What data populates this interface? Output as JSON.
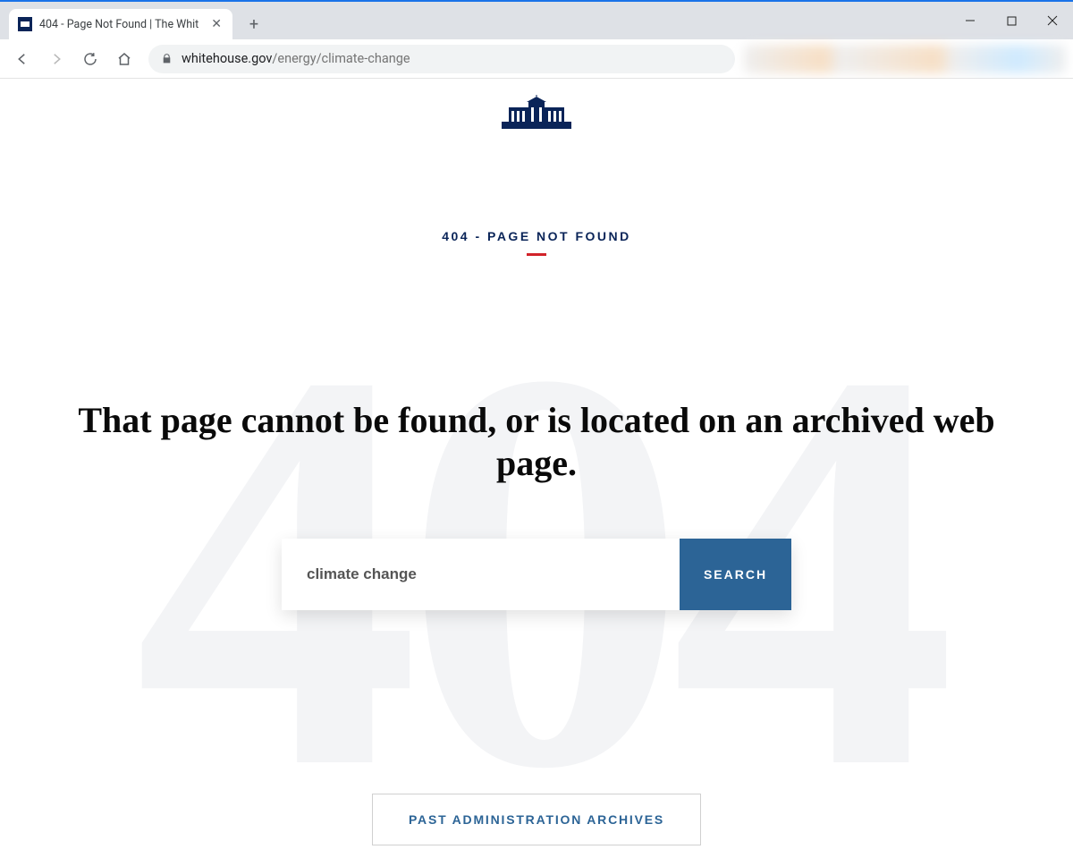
{
  "browser": {
    "tab_title": "404 - Page Not Found | The Whit",
    "url_domain": "whitehouse.gov",
    "url_path": "/energy/climate-change"
  },
  "page": {
    "eyebrow": "404 - PAGE NOT FOUND",
    "bg_number": "404",
    "headline": "That page cannot be found, or is located on an archived web page.",
    "search_value": "climate change",
    "search_button": "SEARCH",
    "archives_button": "PAST ADMINISTRATION ARCHIVES"
  },
  "colors": {
    "navy": "#0a2458",
    "red": "#d1232a",
    "button_blue": "#2c6496"
  }
}
